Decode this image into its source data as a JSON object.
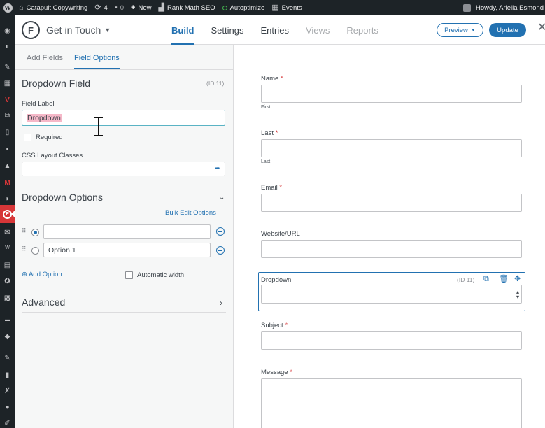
{
  "admin_bar": {
    "site_name": "Catapult Copywriting",
    "updates_count": "4",
    "comments_count": "0",
    "new_label": "New",
    "rank_math_label": "Rank Math SEO",
    "autoptimize_label": "Autoptimize",
    "events_label": "Events",
    "greeting": "Howdy, Ariella Esmond"
  },
  "header": {
    "form_title": "Get in Touch",
    "tabs": [
      {
        "label": "Build"
      },
      {
        "label": "Settings"
      },
      {
        "label": "Entries"
      },
      {
        "label": "Views"
      },
      {
        "label": "Reports"
      }
    ],
    "preview_label": "Preview",
    "update_label": "Update"
  },
  "panel": {
    "tabs": [
      {
        "label": "Add Fields"
      },
      {
        "label": "Field Options"
      }
    ],
    "field_heading": "Dropdown Field",
    "field_id": "(ID 11)",
    "field_label_label": "Field Label",
    "field_label_value": "Dropdown",
    "required_label": "Required",
    "css_classes_label": "CSS Layout Classes",
    "css_more": "•••",
    "options_title": "Dropdown Options",
    "bulk_edit_label": "Bulk Edit Options",
    "options": [
      {
        "value": "",
        "selected": true
      },
      {
        "value": "Option 1",
        "selected": false
      }
    ],
    "add_option_label": "Add Option",
    "auto_width_label": "Automatic width",
    "advanced_title": "Advanced"
  },
  "preview_form": {
    "fields": [
      {
        "label": "Name",
        "required": "*",
        "sublabel": "First"
      },
      {
        "label": "Last",
        "required": "*",
        "sublabel": "Last"
      },
      {
        "label": "Email",
        "required": "*"
      },
      {
        "label": "Website/URL"
      },
      {
        "label": "Dropdown",
        "id_text": "(ID 11)"
      },
      {
        "label": "Subject",
        "required": "*"
      },
      {
        "label": "Message",
        "required": "*"
      }
    ]
  },
  "colors": {
    "admin_dark": "#1d2327",
    "accent_blue": "#2271b1",
    "active_menu_red": "#d63638",
    "required_red": "#d63638",
    "selection_pink": "#f5b8c8"
  },
  "icons": {
    "admin_menu": [
      "dashboard-icon",
      "gauge-icon",
      "pin-icon",
      "calendar-icon",
      "v-logo-icon",
      "copy-pages-icon",
      "pages-icon",
      "comments-icon",
      "lock-icon",
      "m-logo-icon",
      "brush-icon",
      "formidable-icon",
      "mail-icon",
      "woo-icon",
      "grid-icon",
      "accessibility-icon",
      "blocks-icon",
      "woo-store-icon",
      "box-icon",
      "pushpin-icon",
      "book-icon",
      "tools-icon",
      "users-icon",
      "wrench-icon"
    ]
  }
}
